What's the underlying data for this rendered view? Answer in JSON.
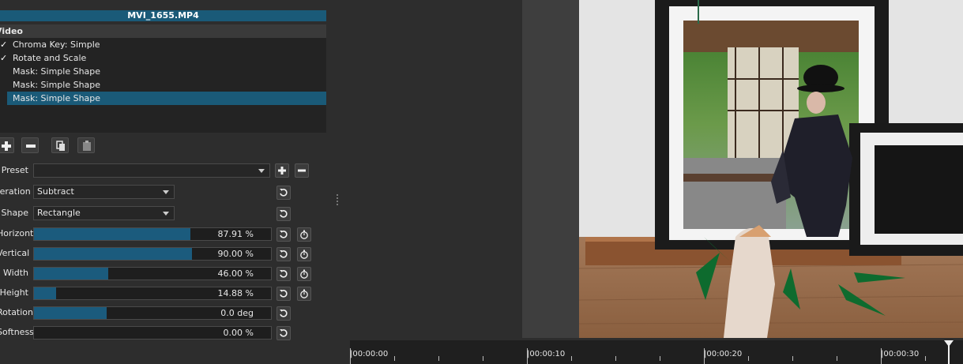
{
  "clip_title": "MVI_1655.MP4",
  "filters": {
    "group_label": "Video",
    "items": [
      {
        "label": "Chroma Key: Simple",
        "checked": true,
        "selected": false
      },
      {
        "label": "Rotate and Scale",
        "checked": true,
        "selected": false
      },
      {
        "label": "Mask: Simple Shape",
        "checked": false,
        "selected": false
      },
      {
        "label": "Mask: Simple Shape",
        "checked": false,
        "selected": false
      },
      {
        "label": "Mask: Simple Shape",
        "checked": false,
        "selected": true
      }
    ]
  },
  "params": {
    "preset_label": "Preset",
    "preset_value": "",
    "operation_label": "Operation",
    "operation_value": "Subtract",
    "shape_label": "Shape",
    "shape_value": "Rectangle",
    "sliders": [
      {
        "label": "Horizontal",
        "value_text": "87.91 %",
        "fraction": 0.6586
      },
      {
        "label": "Vertical",
        "value_text": "90.00 %",
        "fraction": 0.6657
      },
      {
        "label": "Width",
        "value_text": "46.00 %",
        "fraction": 0.3142
      },
      {
        "label": "Height",
        "value_text": "14.88 %",
        "fraction": 0.0929
      },
      {
        "label": "Rotation",
        "value_text": "0.0 deg",
        "fraction": 0.3071
      },
      {
        "label": "Softness",
        "value_text": "0.00 %",
        "fraction": 0.0
      }
    ]
  },
  "timeline": {
    "labels": [
      "|00:00:00",
      "|00:00:10",
      "|00:00:20",
      "|00:00:30"
    ]
  },
  "colors": {
    "accent": "#1a5a78",
    "slider_fill": "#1b5b7d",
    "panel_bg": "#2d2d2d"
  }
}
